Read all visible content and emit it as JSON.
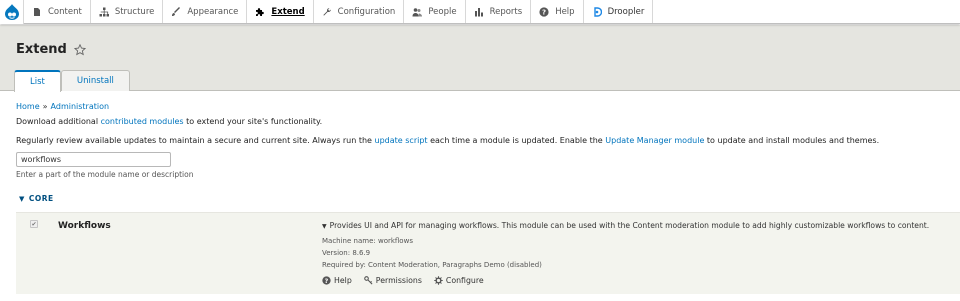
{
  "toolbar": {
    "items": [
      {
        "label": "Content",
        "icon": "file-icon"
      },
      {
        "label": "Structure",
        "icon": "sitemap-icon"
      },
      {
        "label": "Appearance",
        "icon": "paintbrush-icon"
      },
      {
        "label": "Extend",
        "icon": "puzzle-icon"
      },
      {
        "label": "Configuration",
        "icon": "wrench-icon"
      },
      {
        "label": "People",
        "icon": "people-icon"
      },
      {
        "label": "Reports",
        "icon": "bar-chart-icon"
      },
      {
        "label": "Help",
        "icon": "help-icon"
      },
      {
        "label": "Droopler",
        "icon": "droopler-icon"
      }
    ],
    "active": "Extend"
  },
  "page": {
    "title": "Extend",
    "tabs": [
      "List",
      "Uninstall"
    ]
  },
  "breadcrumb": {
    "home": "Home",
    "sep": "»",
    "admin": "Administration"
  },
  "intro": {
    "before": "Download additional ",
    "link": "contributed modules",
    "after": " to extend your site's functionality."
  },
  "review": {
    "t1": "Regularly review available updates to maintain a secure and current site. Always run the ",
    "link1": "update script",
    "t2": " each time a module is updated. Enable the ",
    "link2": "Update Manager module",
    "t3": " to update and install modules and themes."
  },
  "filter": {
    "value": "workflows",
    "help": "Enter a part of the module name or description"
  },
  "section": {
    "label": "CORE",
    "toggle": "▼"
  },
  "module": {
    "name": "Workflows",
    "checked": true,
    "description": "Provides UI and API for managing workflows. This module can be used with the Content moderation module to add highly customizable workflows to content.",
    "machine_name": "Machine name: workflows",
    "version": "Version: 8.6.9",
    "required_by": "Required by: Content Moderation, Paragraphs Demo (disabled)",
    "actions": [
      "Help",
      "Permissions",
      "Configure"
    ]
  },
  "colors": {
    "link": "#0074bd",
    "header_bg": "#e5e5e0",
    "row_bg": "#f3f4ee"
  }
}
